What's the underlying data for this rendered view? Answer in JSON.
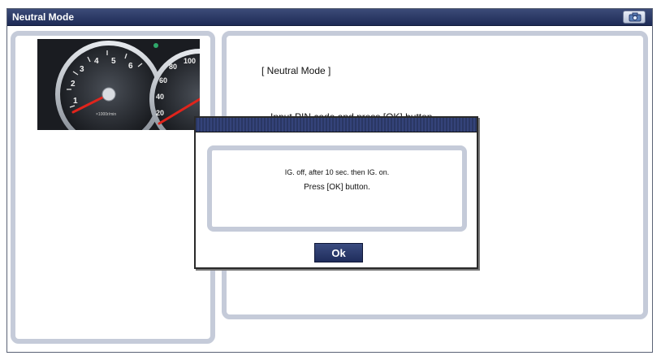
{
  "window": {
    "title": "Neutral Mode",
    "capture_button_icon": "camera-icon"
  },
  "left_panel": {
    "image": {
      "semantic": "instrument-cluster-gauge-image",
      "speedo_ticks": [
        "1",
        "2",
        "3",
        "4",
        "5",
        "6"
      ],
      "speed_ticks": [
        "20",
        "40",
        "60",
        "80",
        "100"
      ],
      "rpm_label": "×1000r/min"
    }
  },
  "right_panel": {
    "heading": "[ Neutral Mode ]",
    "instruction": "Input PIN code and press [OK] button."
  },
  "dialog": {
    "title": "",
    "message_line1": "IG. off, after 10 sec. then IG. on.",
    "message_line2": "Press [OK] button.",
    "ok_label": "Ok"
  },
  "colors": {
    "titlebar": "#1e2b56",
    "panel_border": "#c5cbd9",
    "needle": "#e0241c",
    "button": "#2a3a6e"
  }
}
